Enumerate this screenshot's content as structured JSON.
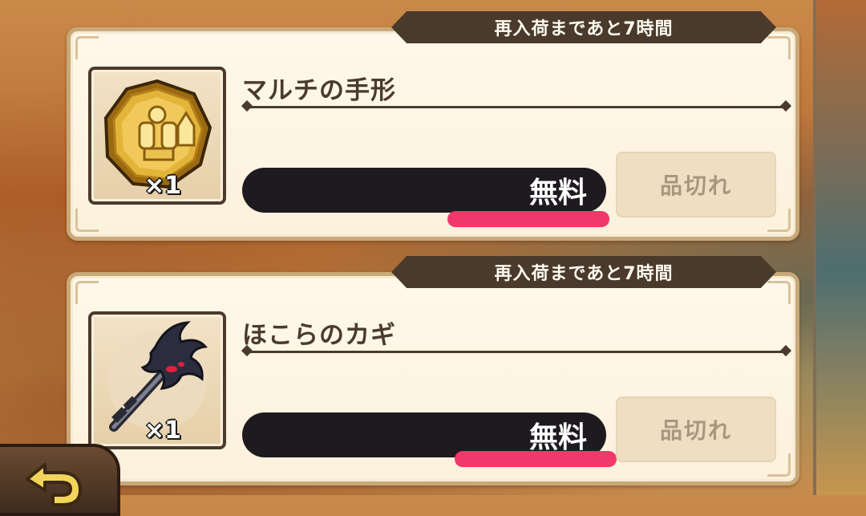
{
  "shop_items": [
    {
      "restock_text": "再入荷まであと7時間",
      "name": "マルチの手形",
      "quantity": "×1",
      "price": "無料",
      "status_button": "品切れ",
      "icon": "gold-medal-icon"
    },
    {
      "restock_text": "再入荷まであと7時間",
      "name": "ほこらのカギ",
      "quantity": "×1",
      "price": "無料",
      "status_button": "品切れ",
      "icon": "dark-key-icon"
    }
  ],
  "back_button": {
    "icon": "back-arrow-icon"
  },
  "colors": {
    "card_bg": "#fff8ea",
    "card_border": "#c8a978",
    "dark_banner": "#4a3a2c",
    "price_bar": "#1e1a20",
    "highlight_underline": "#f0386a",
    "soldout_text": "#a8977e"
  }
}
